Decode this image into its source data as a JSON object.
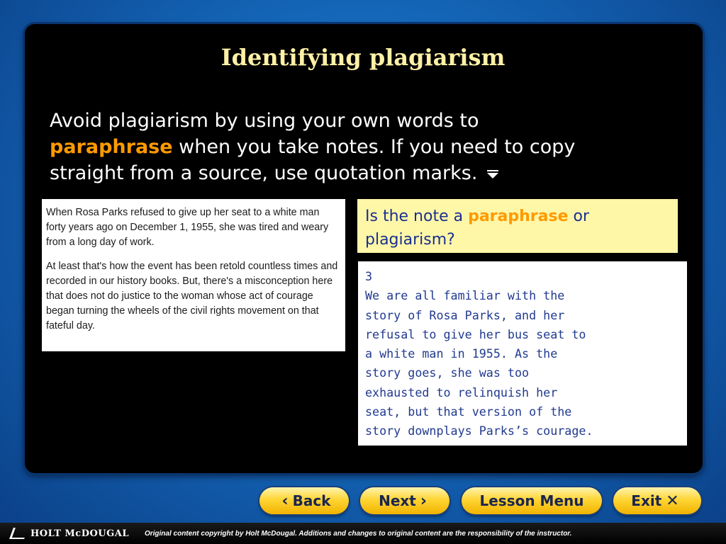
{
  "slide": {
    "title": "Identifying plagiarism",
    "intro": {
      "line1": "Avoid plagiarism by using your own words to",
      "keyword": "paraphrase",
      "line2": " when you take notes. If you need to copy",
      "line3": "straight from a source, use quotation marks."
    },
    "source_text": {
      "p1": "When Rosa Parks refused to give up her seat to a white man forty years ago on December 1, 1955, she was tired and weary from a long day of work.",
      "p2": "At least that's how the event has been retold countless times and recorded in our history books. But, there's a misconception here that does not do justice to the woman whose act of courage began turning the wheels of the civil rights movement on that fateful day."
    },
    "question": {
      "prefix": "Is the note a ",
      "keyword": "paraphrase",
      "suffix": " or plagiarism?"
    },
    "note": {
      "number": "3",
      "text": "We are all familiar with the\nstory of Rosa Parks, and her\nrefusal to give her bus seat to\na white man in 1955. As the\nstory goes, she was too\nexhausted to relinquish her\nseat, but that version of the\nstory downplays Parks’s courage."
    }
  },
  "nav": {
    "back": "Back",
    "next": "Next",
    "lesson_menu": "Lesson Menu",
    "exit": "Exit"
  },
  "footer": {
    "brand": "HOLT McDOUGAL",
    "copyright": "Original content copyright by Holt McDougal. Additions and changes to original content are the responsibility of the instructor."
  },
  "colors": {
    "title": "#fff1a6",
    "highlight": "#ff9a00",
    "question_bg": "#fff7a8",
    "note_text": "#213a8f",
    "button": "#ffd534"
  },
  "icons": [
    "chevron-left-icon",
    "chevron-right-icon",
    "close-icon",
    "arrow-down-icon",
    "holt-logo-icon"
  ]
}
